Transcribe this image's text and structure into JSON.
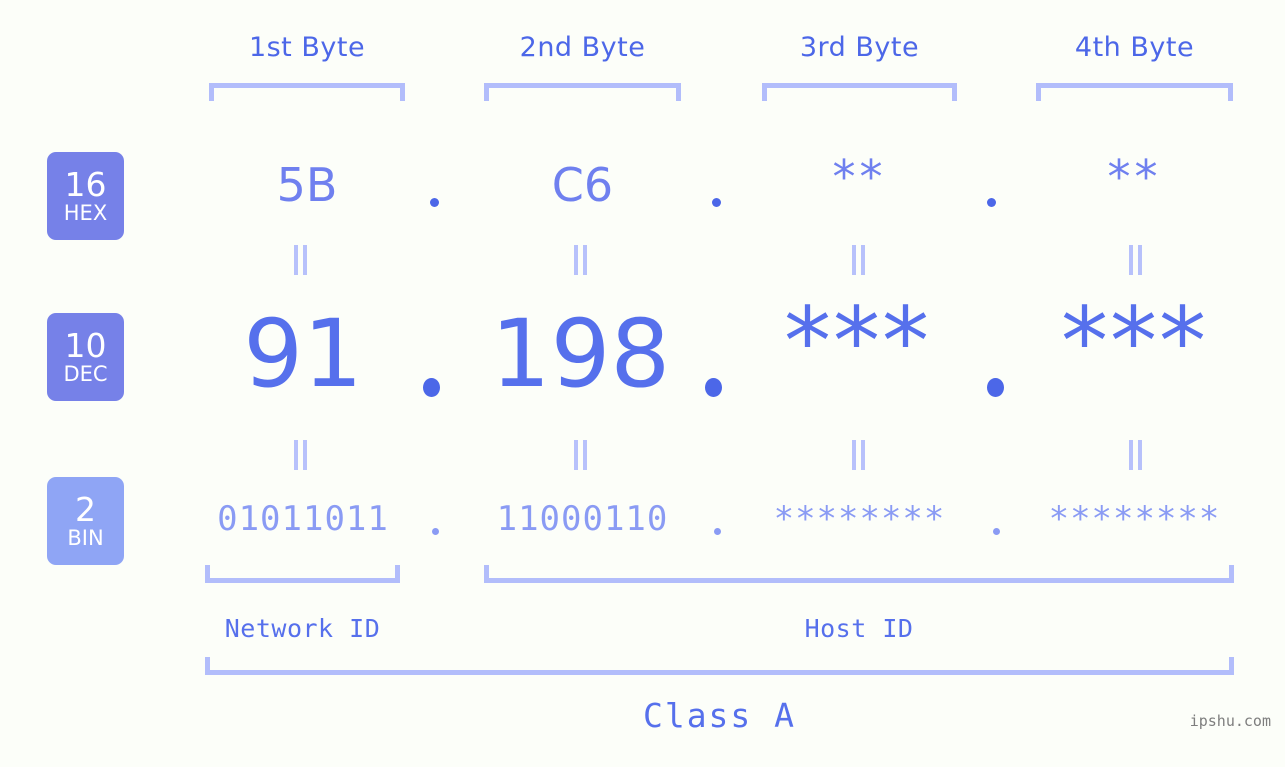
{
  "colors": {
    "background": "#fcfef9",
    "header_text": "#4c67e8",
    "bracket": "#b2bdfb",
    "badge_strong": "#7681e8",
    "badge_light": "#8fa5f5",
    "hex_text": "#6f80ef",
    "dec_text": "#5670ec",
    "bin_text": "#8a9bf4",
    "equals_mark": "#b7c1fb",
    "watermark": "#7e7e7e"
  },
  "header": {
    "byte_labels": [
      "1st Byte",
      "2nd Byte",
      "3rd Byte",
      "4th Byte"
    ]
  },
  "bases": [
    {
      "number": "16",
      "name": "HEX"
    },
    {
      "number": "10",
      "name": "DEC"
    },
    {
      "number": "2",
      "name": "BIN"
    }
  ],
  "rows": {
    "hex": {
      "label_number": "16",
      "label_name": "HEX",
      "octets": [
        "5B",
        "C6",
        "**",
        "**"
      ],
      "separators": [
        ".",
        ".",
        "."
      ]
    },
    "dec": {
      "label_number": "10",
      "label_name": "DEC",
      "octets": [
        "91",
        "198",
        "***",
        "***"
      ],
      "separators": [
        ".",
        ".",
        "."
      ]
    },
    "bin": {
      "label_number": "2",
      "label_name": "BIN",
      "octets": [
        "01011011",
        "11000110",
        "********",
        "********"
      ],
      "separators": [
        ".",
        ".",
        "."
      ]
    }
  },
  "equals_marks": {
    "symbol": "=",
    "count_per_gap": 4,
    "gaps": 2
  },
  "footer": {
    "network_id_label": "Network ID",
    "host_id_label": "Host ID",
    "class_label": "Class A",
    "watermark": "ipshu.com"
  }
}
